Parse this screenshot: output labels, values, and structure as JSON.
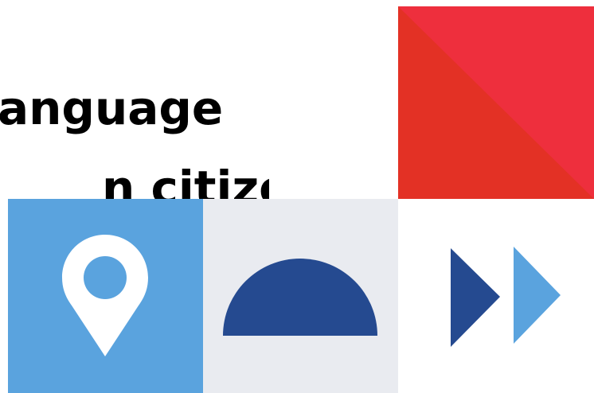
{
  "headline": {
    "line1": "anguage",
    "line2": "n citizens."
  },
  "colors": {
    "red": "#e33125",
    "red_light": "#ee2f3d",
    "blue_light": "#5aa3de",
    "blue_dark": "#254a90",
    "gray_bg": "#e9ebf0",
    "white": "#ffffff"
  },
  "icons": {
    "pin": "location-pin-icon",
    "semicircle": "semicircle-icon",
    "fast_forward": "fast-forward-icon"
  }
}
